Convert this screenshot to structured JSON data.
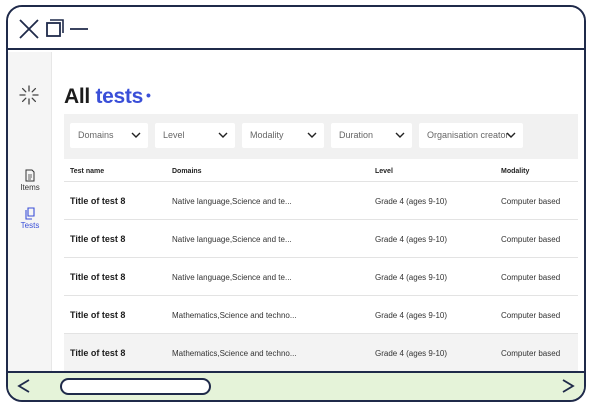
{
  "window": {
    "controls": [
      "close-icon",
      "maximize-icon",
      "minimize-icon"
    ]
  },
  "sidebar": {
    "brand_icon": "starburst-icon",
    "items": [
      {
        "label": "Items",
        "icon": "document-icon"
      },
      {
        "label": "Tests",
        "icon": "copy-icon",
        "active": true
      }
    ]
  },
  "page": {
    "title_plain": "All ",
    "title_accent": "tests",
    "title_dot": "•"
  },
  "filters": [
    {
      "label": "Domains"
    },
    {
      "label": "Level"
    },
    {
      "label": "Modality"
    },
    {
      "label": "Duration"
    },
    {
      "label": "Organisation creator"
    }
  ],
  "table": {
    "columns": [
      "Test name",
      "Domains",
      "Level",
      "Modality"
    ],
    "rows": [
      {
        "name": "Title of test 8",
        "domains": "Native language,Science and te...",
        "level": "Grade 4 (ages 9-10)",
        "modality": "Computer based"
      },
      {
        "name": "Title of test 8",
        "domains": "Native language,Science and te...",
        "level": "Grade 4 (ages 9-10)",
        "modality": "Computer based"
      },
      {
        "name": "Title of test 8",
        "domains": "Native language,Science and te...",
        "level": "Grade 4 (ages 9-10)",
        "modality": "Computer based"
      },
      {
        "name": "Title of test 8",
        "domains": "Mathematics,Science and techno...",
        "level": "Grade 4 (ages 9-10)",
        "modality": "Computer based"
      },
      {
        "name": "Title of test 8",
        "domains": "Mathematics,Science and techno...",
        "level": "Grade 4 (ages 9-10)",
        "modality": "Computer based"
      }
    ]
  },
  "colors": {
    "accent": "#3a4fd8",
    "frame": "#1f2a4a",
    "bottom_bar": "#e5f3d9"
  }
}
